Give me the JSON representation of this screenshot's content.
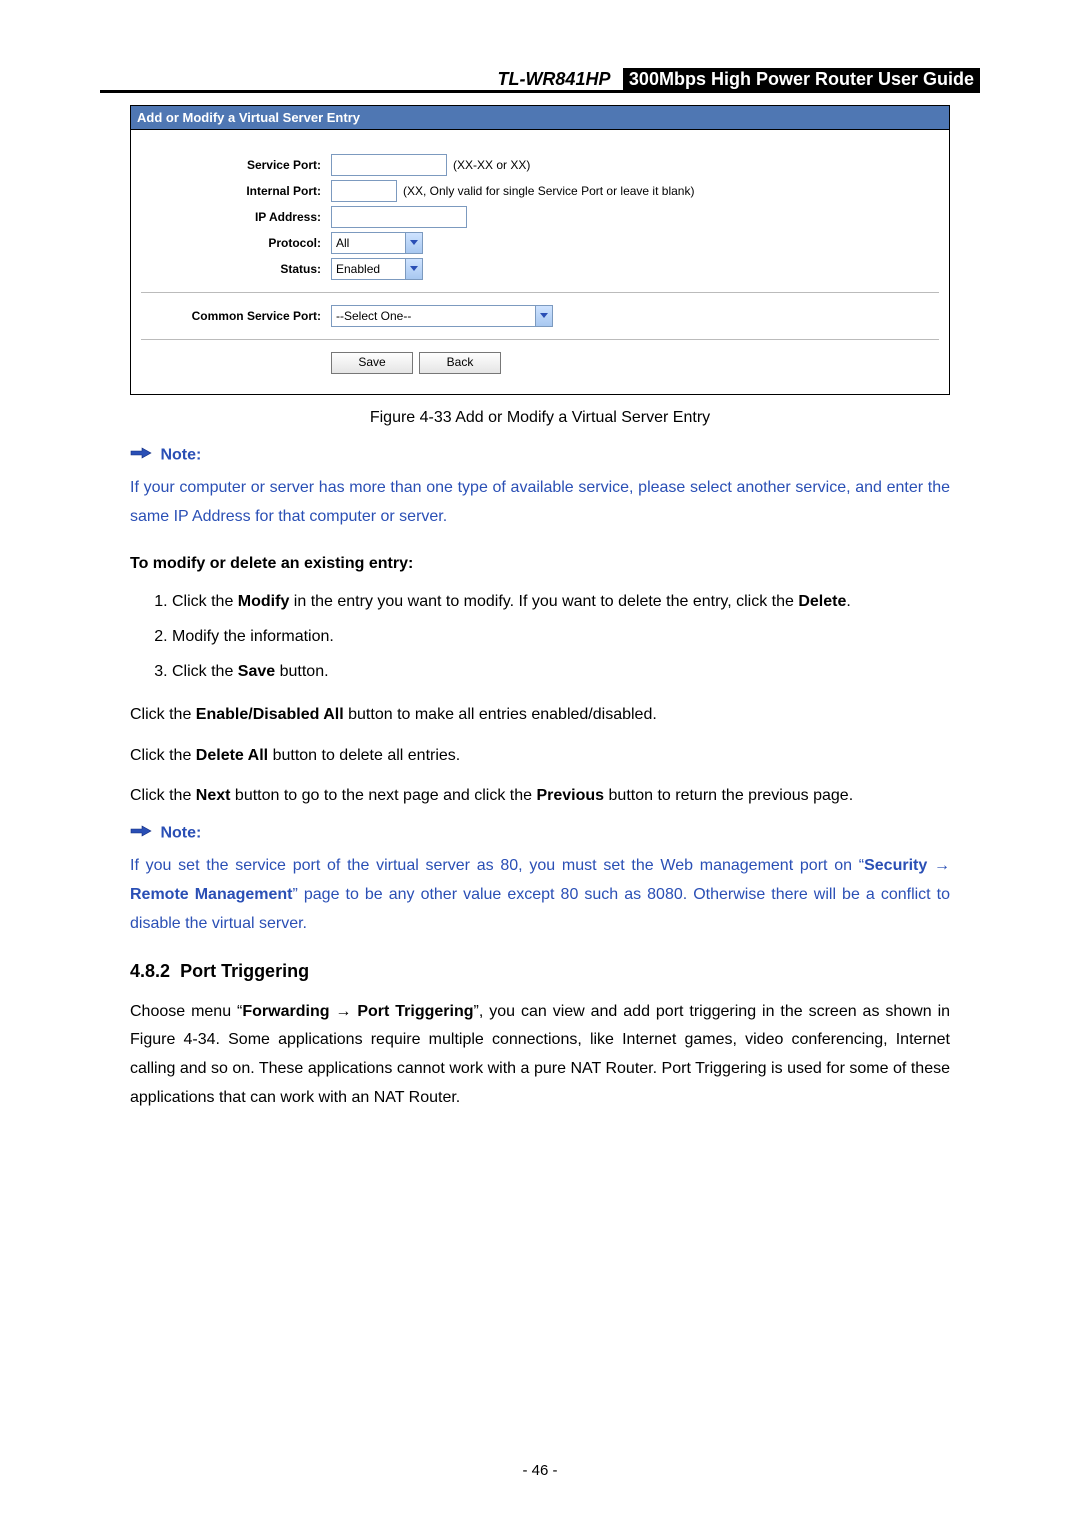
{
  "header": {
    "model": "TL-WR841HP",
    "doc_title": "300Mbps High Power Router User Guide"
  },
  "panel": {
    "title": "Add or Modify a Virtual Server Entry",
    "rows": {
      "service_port": {
        "label": "Service Port:",
        "value": "",
        "hint": "(XX-XX or XX)"
      },
      "internal_port": {
        "label": "Internal Port:",
        "value": "",
        "hint": "(XX, Only valid for single Service Port or leave it blank)"
      },
      "ip_address": {
        "label": "IP Address:",
        "value": ""
      },
      "protocol": {
        "label": "Protocol:",
        "value": "All"
      },
      "status": {
        "label": "Status:",
        "value": "Enabled"
      },
      "common_service_port": {
        "label": "Common Service Port:",
        "value": "--Select One--"
      }
    },
    "buttons": {
      "save": "Save",
      "back": "Back"
    }
  },
  "figure_caption": "Figure 4-33    Add or Modify a Virtual Server Entry",
  "note_label": "Note:",
  "note1_text": "If your computer or server has more than one type of available service, please select another service, and enter the same IP Address for that computer or server.",
  "modify_heading": "To modify or delete an existing entry:",
  "steps": {
    "s1a": "Click the ",
    "s1b": "Modify",
    "s1c": " in the entry you want to modify. If you want to delete the entry, click the ",
    "s1d": "Delete",
    "s1e": ".",
    "s2": "Modify the information.",
    "s3a": "Click the ",
    "s3b": "Save",
    "s3c": " button."
  },
  "paras": {
    "p1a": "Click the ",
    "p1b": "Enable/Disabled All",
    "p1c": " button to make all entries enabled/disabled.",
    "p2a": "Click the ",
    "p2b": "Delete All",
    "p2c": " button to delete all entries.",
    "p3a": "Click the ",
    "p3b": "Next",
    "p3c": " button to go to the next page and click the ",
    "p3d": "Previous",
    "p3e": " button to return the previous page."
  },
  "note2": {
    "t1": "If you set the service port of the virtual server as 80, you must set the Web management port on “",
    "t2": "Security",
    "t3": " → ",
    "t4": "Remote Management",
    "t5": "” page to be any other value except 80 such as 8080. Otherwise there will be a conflict to disable the virtual server."
  },
  "section": {
    "number": "4.8.2",
    "title": "Port Triggering",
    "p1a": "Choose menu “",
    "p1b": "Forwarding",
    "p1c": " → ",
    "p1d": "Port Triggering",
    "p1e": "”, you can view and add port triggering in the screen as shown in Figure 4-34. Some applications require multiple connections, like Internet games, video conferencing, Internet calling and so on. These applications cannot work with a pure NAT Router. Port Triggering is used for some of these applications that can work with an NAT Router."
  },
  "page_number": "- 46 -"
}
